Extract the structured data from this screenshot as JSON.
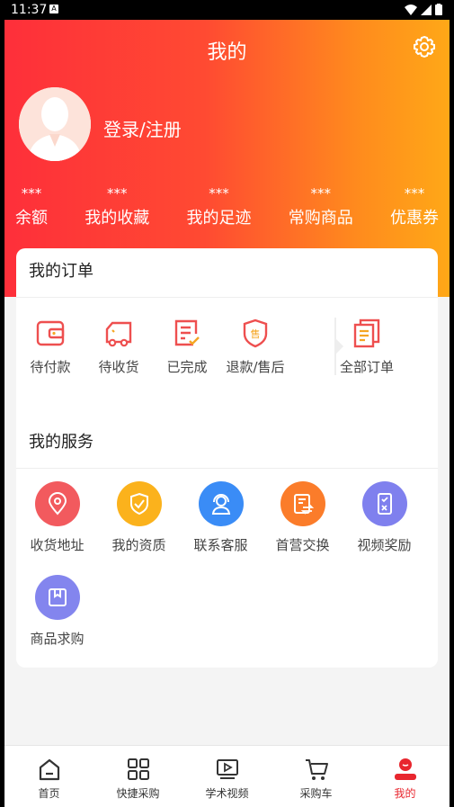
{
  "status": {
    "time": "11:37",
    "notif": "A"
  },
  "header": {
    "title": "我的"
  },
  "profile": {
    "login_label": "登录/注册"
  },
  "stats": [
    {
      "value": "***",
      "label": "余额"
    },
    {
      "value": "***",
      "label": "我的收藏"
    },
    {
      "value": "***",
      "label": "我的足迹"
    },
    {
      "value": "***",
      "label": "常购商品"
    },
    {
      "value": "***",
      "label": "优惠券"
    }
  ],
  "orders": {
    "title": "我的订单",
    "items": [
      {
        "label": "待付款",
        "icon": "wallet-icon"
      },
      {
        "label": "待收货",
        "icon": "truck-icon"
      },
      {
        "label": "已完成",
        "icon": "completed-doc-icon"
      },
      {
        "label": "退款/售后",
        "icon": "after-sale-shield-icon"
      },
      {
        "label": "全部订单",
        "icon": "all-orders-icon"
      }
    ]
  },
  "services": {
    "title": "我的服务",
    "items": [
      {
        "label": "收货地址",
        "icon": "location-icon",
        "color": "#f25a5e"
      },
      {
        "label": "我的资质",
        "icon": "shield-check-icon",
        "color": "#fbb21c"
      },
      {
        "label": "联系客服",
        "icon": "customer-service-icon",
        "color": "#3a8cf6"
      },
      {
        "label": "首营交换",
        "icon": "exchange-doc-icon",
        "color": "#fb7c2a"
      },
      {
        "label": "视频奖励",
        "icon": "video-reward-icon",
        "color": "#7f80ee"
      },
      {
        "label": "商品求购",
        "icon": "product-request-icon",
        "color": "#8385ee"
      }
    ]
  },
  "tabbar": {
    "items": [
      {
        "label": "首页",
        "icon": "home-icon"
      },
      {
        "label": "快捷采购",
        "icon": "quick-purchase-icon"
      },
      {
        "label": "学术视频",
        "icon": "video-icon"
      },
      {
        "label": "采购车",
        "icon": "cart-icon"
      },
      {
        "label": "我的",
        "icon": "profile-icon"
      }
    ],
    "active_color": "#e8262e"
  }
}
